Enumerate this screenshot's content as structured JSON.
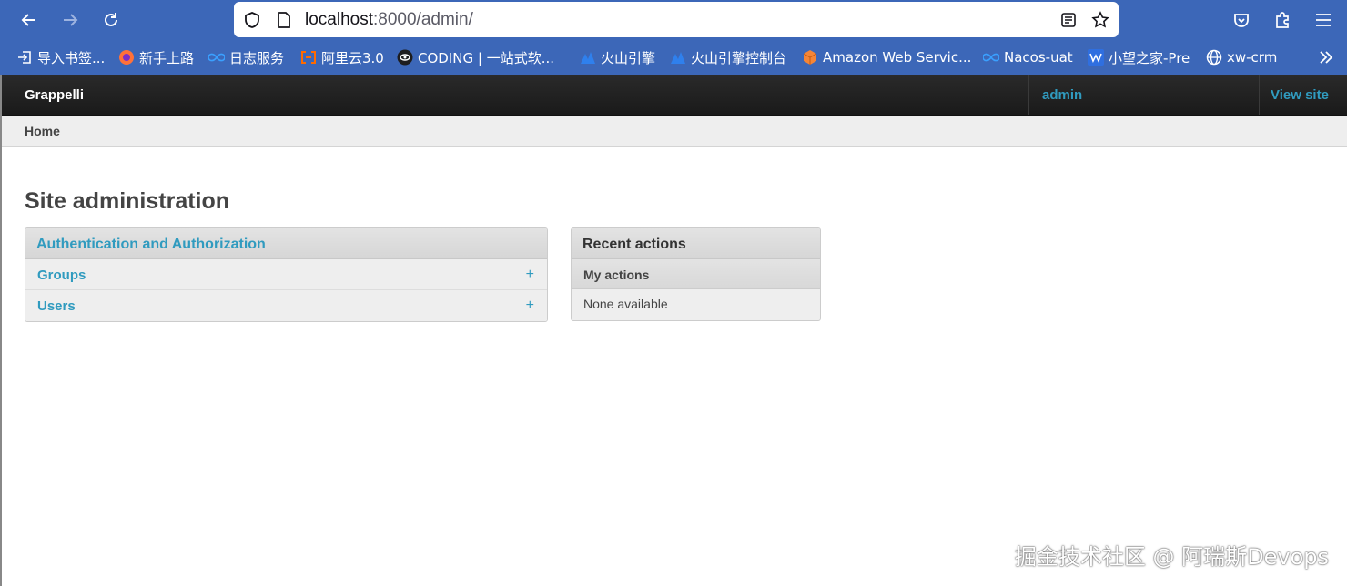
{
  "browser": {
    "url_host": "localhost",
    "url_rest": ":8000/admin/",
    "bookmarks": [
      {
        "label": "导入书签...",
        "icon": "import-icon"
      },
      {
        "label": "新手上路",
        "icon": "firefox-icon"
      },
      {
        "label": "日志服务",
        "icon": "infinity-icon"
      },
      {
        "label": "阿里云3.0",
        "icon": "aliyun-icon"
      },
      {
        "label": "CODING | 一站式软...",
        "icon": "coding-icon"
      },
      {
        "label": "火山引擎",
        "icon": "volcano-icon"
      },
      {
        "label": "火山引擎控制台",
        "icon": "volcano-icon"
      },
      {
        "label": "Amazon Web Servic...",
        "icon": "aws-cube-icon"
      },
      {
        "label": "Nacos-uat",
        "icon": "infinity-icon"
      },
      {
        "label": "小望之家-Pre",
        "icon": "w-logo-icon"
      },
      {
        "label": "xw-crm",
        "icon": "globe-icon"
      }
    ]
  },
  "header": {
    "brand": "Grappelli",
    "user": "admin",
    "view_site": "View site"
  },
  "breadcrumb": {
    "home": "Home"
  },
  "page": {
    "title": "Site administration"
  },
  "auth_module": {
    "title": "Authentication and Authorization",
    "rows": [
      {
        "label": "Groups",
        "add": "+"
      },
      {
        "label": "Users",
        "add": "+"
      }
    ]
  },
  "recent_actions": {
    "title": "Recent actions",
    "subtitle": "My actions",
    "empty": "None available"
  },
  "watermark": "掘金技术社区 @ 阿瑞斯Devops",
  "colors": {
    "browser_blue": "#3c67b8",
    "link": "#309bbf",
    "header_dark": "#222222",
    "module_bg": "#eeeeee"
  }
}
